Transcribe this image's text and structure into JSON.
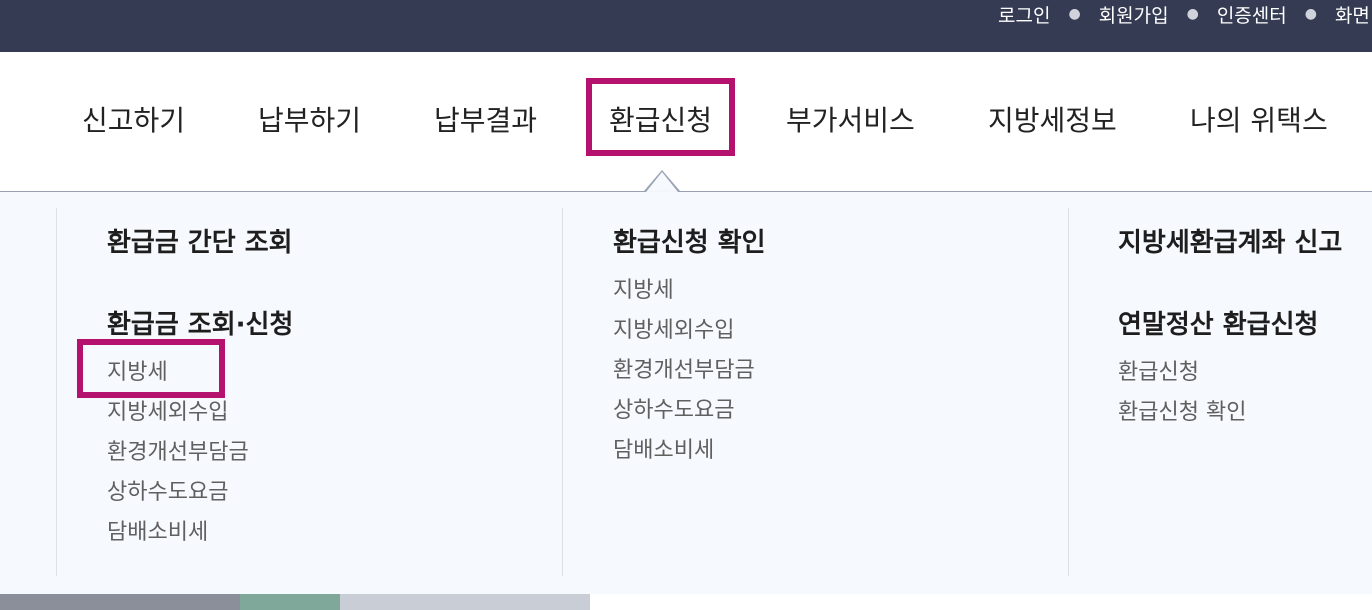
{
  "utility_links": [
    "로그인",
    "회원가입",
    "인증센터",
    "화면"
  ],
  "nav": [
    "신고하기",
    "납부하기",
    "납부결과",
    "환급신청",
    "부가서비스",
    "지방세정보",
    "나의 위택스"
  ],
  "columns": [
    {
      "groups": [
        {
          "title": "환급금 간단 조회",
          "items": []
        },
        {
          "title": "환급금 조회·신청",
          "items": [
            "지방세",
            "지방세외수입",
            "환경개선부담금",
            "상하수도요금",
            "담배소비세"
          ]
        }
      ]
    },
    {
      "groups": [
        {
          "title": "환급신청 확인",
          "items": [
            "지방세",
            "지방세외수입",
            "환경개선부담금",
            "상하수도요금",
            "담배소비세"
          ]
        }
      ]
    },
    {
      "groups": [
        {
          "title": "지방세환급계좌 신고",
          "items": []
        },
        {
          "title": "연말정산 환급신청",
          "items": [
            "환급신청",
            "환급신청 확인"
          ]
        }
      ]
    }
  ],
  "colors": {
    "topbar": "#353b52",
    "highlight": "#b5116e",
    "submenu_bg": "#f6f9fd"
  }
}
